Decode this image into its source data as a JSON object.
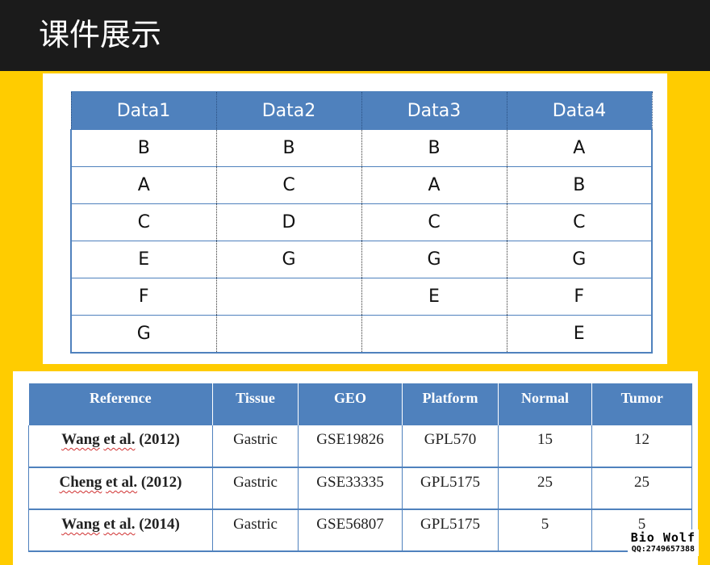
{
  "header": {
    "title": "课件展示"
  },
  "table1": {
    "columns": [
      "Data1",
      "Data2",
      "Data3",
      "Data4"
    ],
    "rows": [
      [
        "B",
        "B",
        "B",
        "A"
      ],
      [
        "A",
        "C",
        "A",
        "B"
      ],
      [
        "C",
        "D",
        "C",
        "C"
      ],
      [
        "E",
        "G",
        "G",
        "G"
      ],
      [
        "F",
        "",
        "E",
        "F"
      ],
      [
        "G",
        "",
        "",
        "E"
      ]
    ]
  },
  "table2": {
    "columns": [
      "Reference",
      "Tissue",
      "GEO",
      "Platform",
      "Normal",
      "Tumor"
    ],
    "rows": [
      {
        "ref_name": "Wang",
        "ref_etal": "et al.",
        "ref_year": "(2012)",
        "tissue": "Gastric",
        "geo": "GSE19826",
        "platform": "GPL570",
        "normal": "15",
        "tumor": "12"
      },
      {
        "ref_name": "Cheng",
        "ref_etal": "et al.",
        "ref_year": "(2012)",
        "tissue": "Gastric",
        "geo": "GSE33335",
        "platform": "GPL5175",
        "normal": "25",
        "tumor": "25"
      },
      {
        "ref_name": "Wang",
        "ref_etal": "et al.",
        "ref_year": "(2014)",
        "tissue": "Gastric",
        "geo": "GSE56807",
        "platform": "GPL5175",
        "normal": "5",
        "tumor": "5"
      }
    ]
  },
  "watermark": {
    "main": "Bio Wolf",
    "sub": "QQ:2749657388"
  },
  "colors": {
    "background": "#ffcc00",
    "header_bar": "#1b1b1b",
    "table_header": "#4f81bd"
  }
}
